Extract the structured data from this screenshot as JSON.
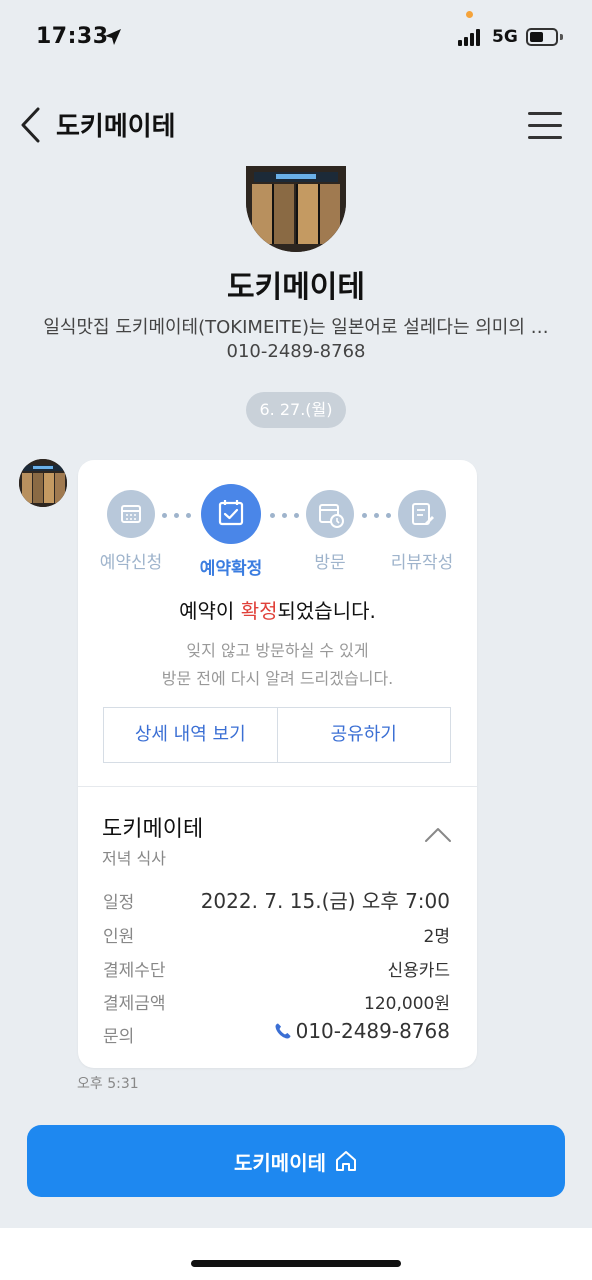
{
  "status_bar": {
    "time": "17:33",
    "network": "5G"
  },
  "header": {
    "title": "도키메이테"
  },
  "profile": {
    "name": "도키메이테",
    "description": "일식맛집 도키메이테(TOKIMEITE)는 일본어로 설레다는 의미의 …",
    "phone": "010-2489-8768"
  },
  "chat": {
    "date": "6. 27.(월)",
    "steps": [
      {
        "label": "예약신청",
        "icon": "calendar-icon"
      },
      {
        "label": "예약확정",
        "icon": "calendar-check-icon"
      },
      {
        "label": "방문",
        "icon": "calendar-clock-icon"
      },
      {
        "label": "리뷰작성",
        "icon": "edit-note-icon"
      }
    ],
    "confirm_pre": "예약이 ",
    "confirm_hl": "확정",
    "confirm_post": "되었습니다.",
    "sub_line1": "잊지 않고 방문하실 수 있게",
    "sub_line2": "방문 전에 다시 알려 드리겠습니다.",
    "btn_detail": "상세 내역 보기",
    "btn_share": "공유하기",
    "detail": {
      "name": "도키메이테",
      "sub": "저녁 식사",
      "rows": [
        {
          "label": "일정",
          "value": "2022. 7. 15.(금) 오후 7:00"
        },
        {
          "label": "인원",
          "value": "2명"
        },
        {
          "label": "결제수단",
          "value": "신용카드"
        },
        {
          "label": "결제금액",
          "value": "120,000원"
        },
        {
          "label": "문의",
          "value": "010-2489-8768"
        }
      ]
    },
    "time": "오후 5:31"
  },
  "home_button": {
    "label": "도키메이테"
  },
  "colors": {
    "accent": "#1e88f0",
    "step_active": "#4a86e8",
    "step_inactive": "#b8c8da",
    "highlight": "#e0413a"
  }
}
